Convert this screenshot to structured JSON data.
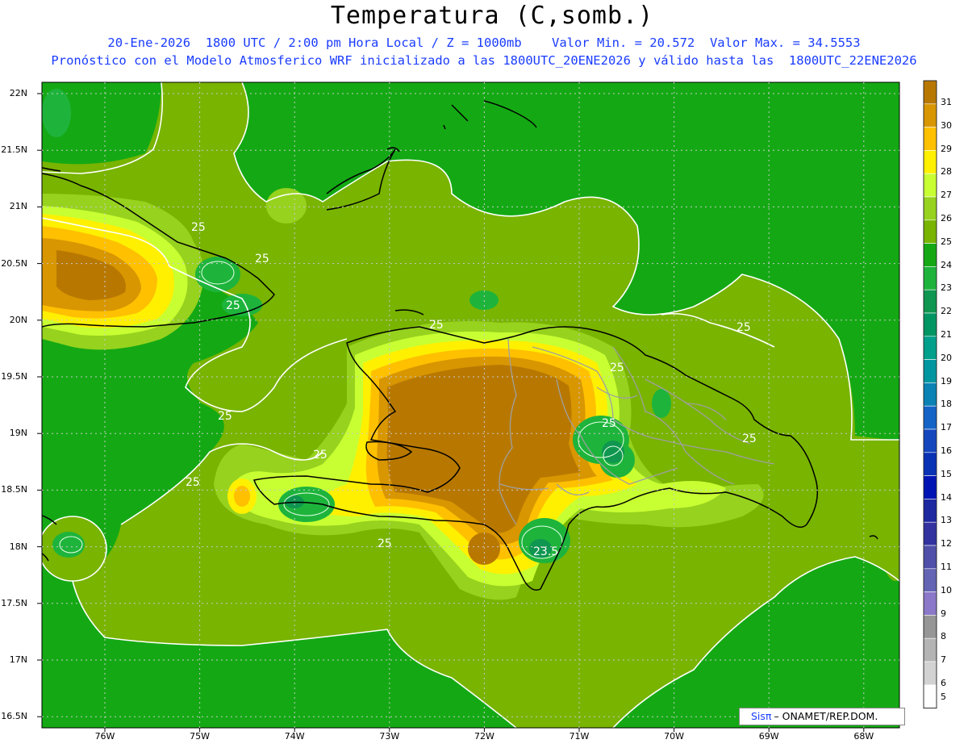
{
  "title": "Temperatura (C,somb.)",
  "subtitle_line1": "20-Ene-2026  1800 UTC / 2:00 pm Hora Local / Z = 1000mb    Valor Min. = 20.572  Valor Max. = 34.5553",
  "subtitle_line2": "Pronóstico con el Modelo Atmosferico WRF inicializado a las 1800UTC_20ENE2026 y válido hasta las  1800UTC_22ENE2026",
  "credit": {
    "brand": "Sisπ",
    "text": "– ONAMET/REP.DOM."
  },
  "axes": {
    "lat_labels": [
      "22N",
      "21.5N",
      "21N",
      "20.5N",
      "20N",
      "19.5N",
      "19N",
      "18.5N",
      "18N",
      "17.5N",
      "17N",
      "16.5N"
    ],
    "lon_labels": [
      "76W",
      "75W",
      "74W",
      "73W",
      "72W",
      "71W",
      "70W",
      "69W",
      "68W"
    ]
  },
  "colorbar": {
    "labels": [
      "31",
      "30",
      "29",
      "28",
      "27",
      "26",
      "25",
      "24",
      "23",
      "22",
      "21",
      "20",
      "19",
      "18",
      "17",
      "16",
      "15",
      "14",
      "13",
      "12",
      "11",
      "10",
      "9",
      "8",
      "7",
      "6",
      "5"
    ],
    "colors": [
      "#b87800",
      "#d89600",
      "#ffc000",
      "#fff000",
      "#c8ff32",
      "#96d21e",
      "#78b400",
      "#14a914",
      "#1eb43c",
      "#0f9650",
      "#009664",
      "#00a08c",
      "#0096a0",
      "#0a82b4",
      "#1464c8",
      "#1446be",
      "#0a32b4",
      "#0014b4",
      "#1e28a0",
      "#3232a0",
      "#5050aa",
      "#6464b4",
      "#8c78c8",
      "#969696",
      "#b4b4b4",
      "#d2d2d2",
      "#ffffff"
    ]
  },
  "contour_labels": [
    "25",
    "25",
    "25",
    "25",
    "25",
    "25",
    "25",
    "25",
    "25",
    "25",
    "25",
    "25",
    "23.5"
  ],
  "colors": {
    "background_field": "#14a914",
    "title_color": "#000000",
    "subtitle_color": "#1a3cff",
    "coastline": "#000000",
    "borders": "#a0a0a0",
    "contour_line": "#ffffff"
  }
}
